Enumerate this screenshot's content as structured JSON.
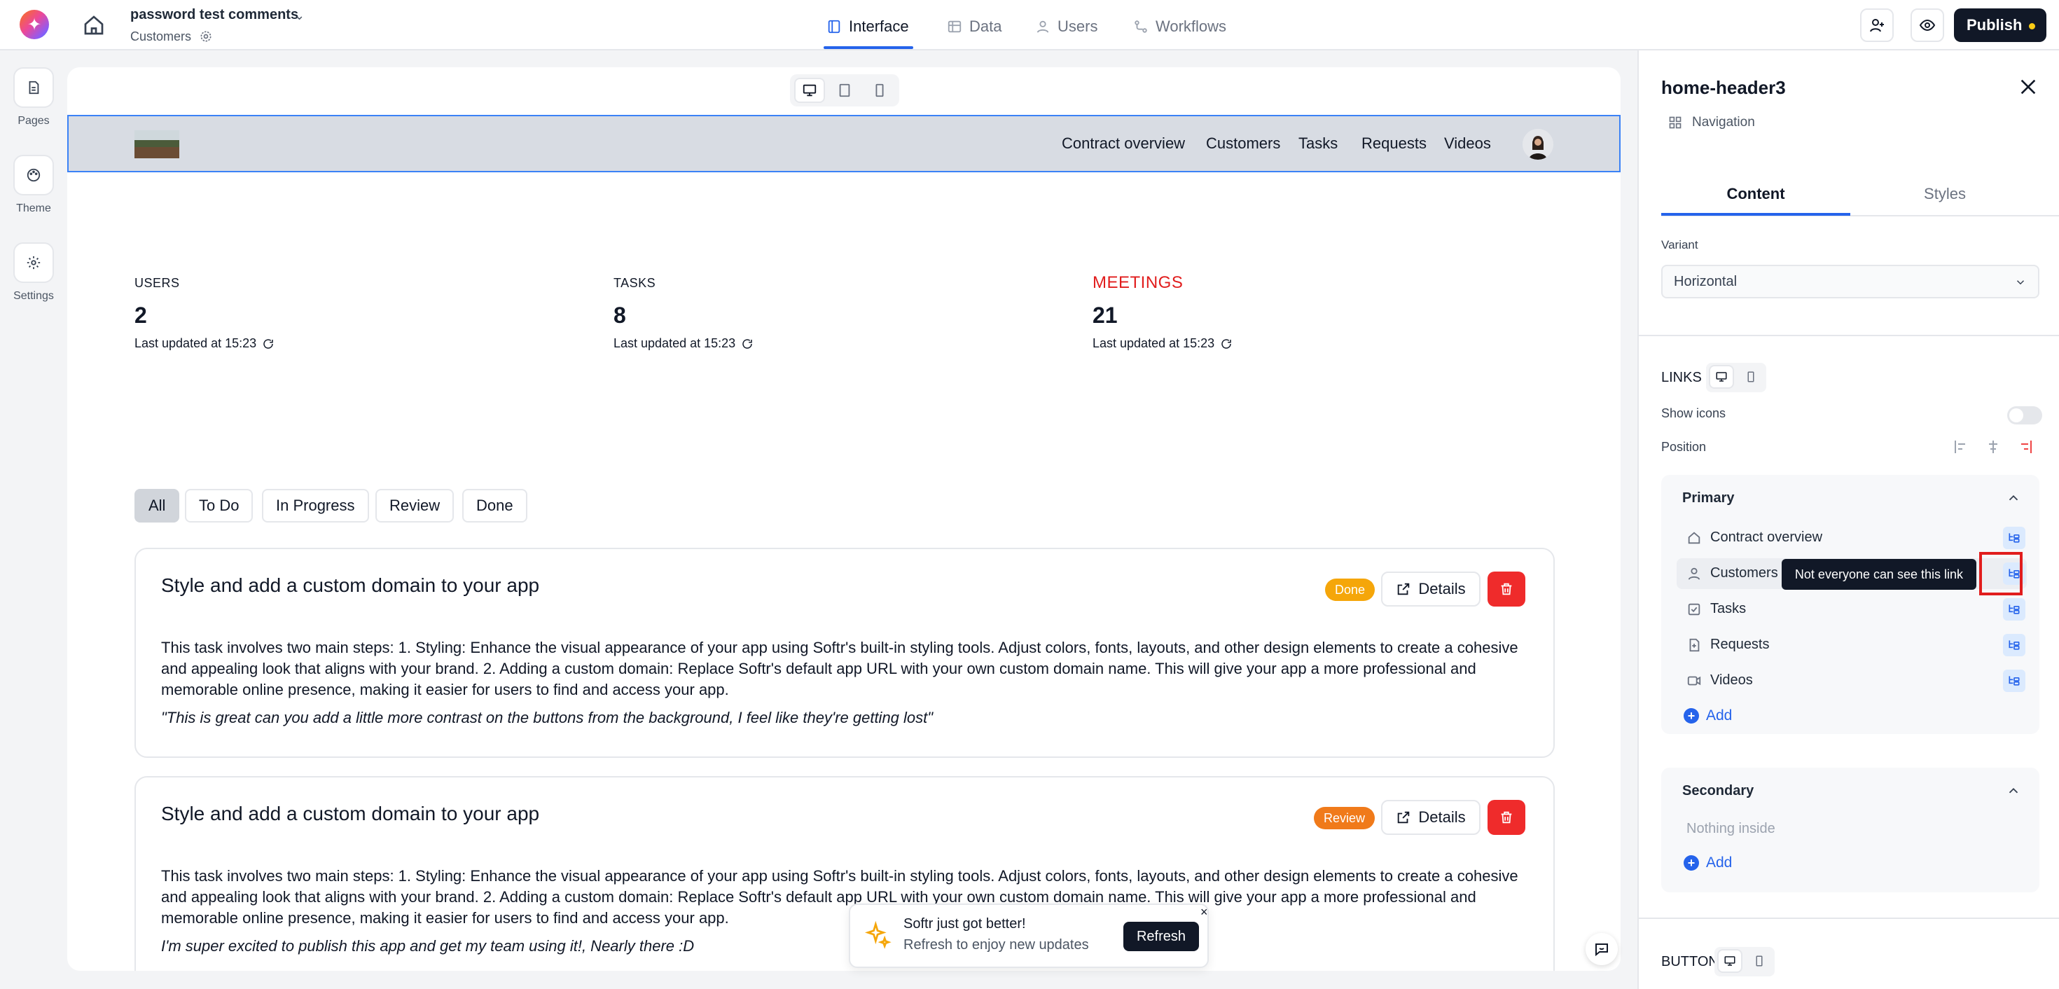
{
  "app": {
    "project_title": "password test comments",
    "project_sub": "Customers",
    "tabs": [
      {
        "label": "Interface",
        "icon": "layout-icon",
        "active": true
      },
      {
        "label": "Data",
        "icon": "table-icon"
      },
      {
        "label": "Users",
        "icon": "user-icon"
      },
      {
        "label": "Workflows",
        "icon": "workflow-icon"
      }
    ],
    "publish_label": "Publish",
    "accent": "#2563eb"
  },
  "rail": [
    {
      "label": "Pages",
      "icon": "page-icon"
    },
    {
      "label": "Theme",
      "icon": "palette-icon"
    },
    {
      "label": "Settings",
      "icon": "gear-icon"
    }
  ],
  "site": {
    "links": [
      "Contract overview",
      "Customers",
      "Tasks",
      "Requests",
      "Videos"
    ]
  },
  "stats": [
    {
      "label": "USERS",
      "value": "2",
      "updated": "Last updated at 15:23"
    },
    {
      "label": "TASKS",
      "value": "8",
      "updated": "Last updated at 15:23"
    },
    {
      "label": "MEETINGS",
      "value": "21",
      "updated": "Last updated at 15:23",
      "color": "#e11d1d"
    }
  ],
  "filters": [
    "All",
    "To Do",
    "In Progress",
    "Review",
    "Done"
  ],
  "cards": [
    {
      "title": "Style and add a custom domain to your app",
      "badge": "Done",
      "badge_color": "#f5a60a",
      "details_label": "Details",
      "body": "This task involves two main steps: 1. Styling: Enhance the visual appearance of your app using Softr's built-in styling tools. Adjust colors, fonts, layouts, and other design elements to create a cohesive and appealing look that aligns with your brand. 2. Adding a custom domain: Replace Softr's default app URL with your own custom domain name. This will give your app a more professional and memorable online presence, making it easier for users to find and access your app.",
      "quote": "\"This is great can you add a little more contrast on the buttons from the background, I feel like they're getting lost\""
    },
    {
      "title": "Style and add a custom domain to your app",
      "badge": "Review",
      "badge_color": "#f07a1a",
      "details_label": "Details",
      "body": "This task involves two main steps: 1. Styling: Enhance the visual appearance of your app using Softr's built-in styling tools. Adjust colors, fonts, layouts, and other design elements to create a cohesive and appealing look that aligns with your brand. 2. Adding a custom domain: Replace Softr's default app URL with your own custom domain name. This will give your app a more professional and memorable online presence, making it easier for users to find and access your app.",
      "quote": "I'm super excited to publish this app and get my team using it!, Nearly there :D"
    }
  ],
  "toast": {
    "title": "Softr just got better!",
    "sub": "Refresh to enjoy new updates",
    "button": "Refresh",
    "close": "×"
  },
  "panel": {
    "title": "home-header3",
    "subtitle": "Navigation",
    "tabs": [
      "Content",
      "Styles"
    ],
    "variant_label": "Variant",
    "variant_value": "Horizontal",
    "links_label": "LINKS",
    "show_icons_label": "Show icons",
    "position_label": "Position",
    "primary": {
      "title": "Primary",
      "items": [
        {
          "label": "Contract overview",
          "icon": "home-icon"
        },
        {
          "label": "Customers",
          "icon": "user-icon"
        },
        {
          "label": "Tasks",
          "icon": "checkbox-icon"
        },
        {
          "label": "Requests",
          "icon": "document-icon"
        },
        {
          "label": "Videos",
          "icon": "video-icon"
        }
      ],
      "add_label": "Add"
    },
    "secondary": {
      "title": "Secondary",
      "empty": "Nothing inside",
      "add_label": "Add"
    },
    "buttons_label": "BUTTONS",
    "tooltip": "Not everyone can see this link"
  }
}
